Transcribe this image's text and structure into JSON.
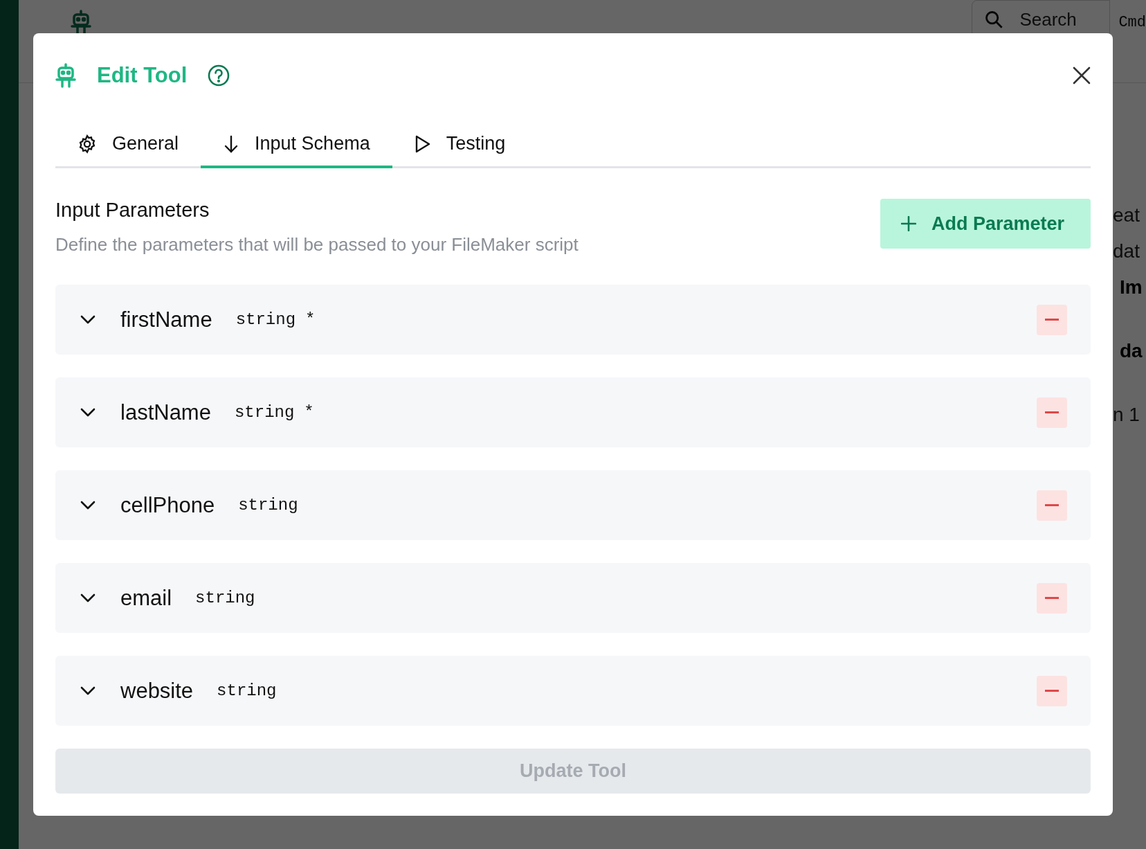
{
  "background": {
    "search": {
      "placeholder": "Search"
    },
    "shortcut": "Cmd",
    "fragments": [
      {
        "text": "eat",
        "bold": false
      },
      {
        "text": "dat",
        "bold": false
      },
      {
        "text": "Im",
        "bold": true
      },
      {
        "text": "da",
        "bold": true
      },
      {
        "text": "n 1",
        "bold": false
      }
    ]
  },
  "dialog": {
    "title": "Edit Tool",
    "tabs": [
      {
        "label": "General",
        "selected": false
      },
      {
        "label": "Input Schema",
        "selected": true
      },
      {
        "label": "Testing",
        "selected": false
      }
    ],
    "section": {
      "title": "Input Parameters",
      "description": "Define the parameters that will be passed to your FileMaker script"
    },
    "add_button": "Add Parameter",
    "parameters": [
      {
        "name": "firstName",
        "type": "string",
        "required_mark": "*",
        "expanded": false
      },
      {
        "name": "lastName",
        "type": "string",
        "required_mark": "*",
        "expanded": false
      },
      {
        "name": "cellPhone",
        "type": "string",
        "expanded": false
      },
      {
        "name": "email",
        "type": "string",
        "expanded": false
      },
      {
        "name": "website",
        "type": "string",
        "expanded": false
      }
    ],
    "submit_button": {
      "label": "Update Tool",
      "disabled": true
    }
  }
}
